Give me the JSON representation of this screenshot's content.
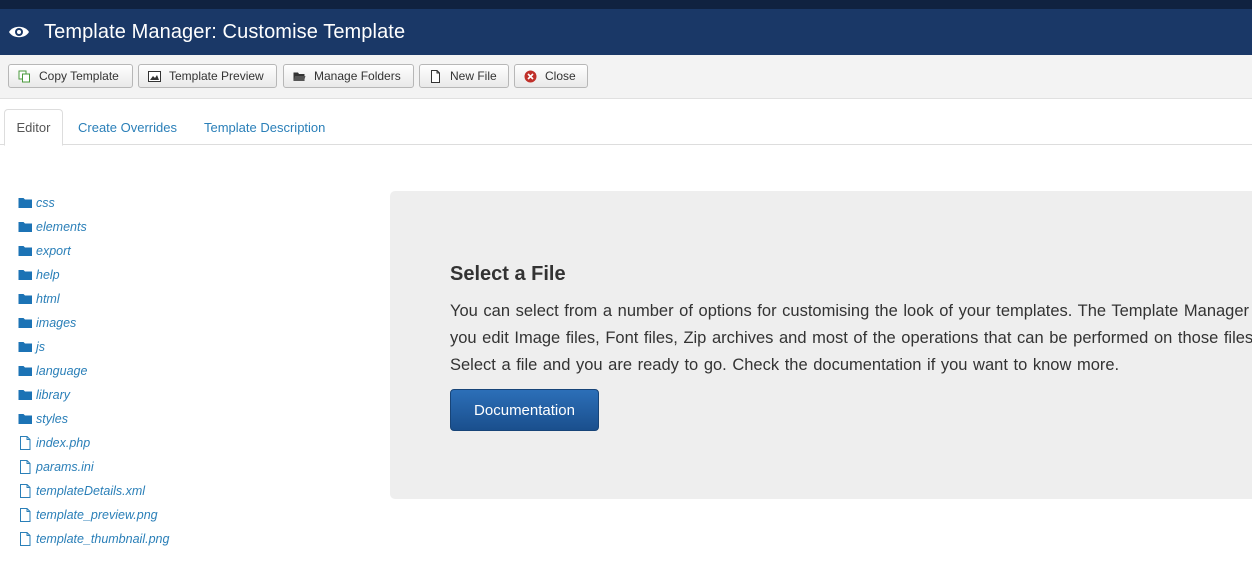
{
  "header": {
    "title": "Template Manager: Customise Template",
    "icon": "eye-icon"
  },
  "toolbar": {
    "copy_label": "Copy Template",
    "preview_label": "Template Preview",
    "folders_label": "Manage Folders",
    "newfile_label": "New File",
    "close_label": "Close"
  },
  "tabs": [
    {
      "label": "Editor",
      "active": true
    },
    {
      "label": "Create Overrides",
      "active": false
    },
    {
      "label": "Template Description",
      "active": false
    }
  ],
  "tree": [
    {
      "label": "css",
      "type": "folder"
    },
    {
      "label": "elements",
      "type": "folder"
    },
    {
      "label": "export",
      "type": "folder"
    },
    {
      "label": "help",
      "type": "folder"
    },
    {
      "label": "html",
      "type": "folder"
    },
    {
      "label": "images",
      "type": "folder"
    },
    {
      "label": "js",
      "type": "folder"
    },
    {
      "label": "language",
      "type": "folder"
    },
    {
      "label": "library",
      "type": "folder"
    },
    {
      "label": "styles",
      "type": "folder"
    },
    {
      "label": "index.php",
      "type": "file"
    },
    {
      "label": "params.ini",
      "type": "file"
    },
    {
      "label": "templateDetails.xml",
      "type": "file"
    },
    {
      "label": "template_preview.png",
      "type": "file"
    },
    {
      "label": "template_thumbnail.png",
      "type": "file"
    }
  ],
  "panel": {
    "heading": "Select a File",
    "text": "You can select from a number of options for customising the look of your templates. The Template Manager lets you edit Image files, Font files, Zip archives and most of the operations that can be performed on those files. Select a file and you are ready to go. Check the documentation if you want to know more.",
    "button_label": "Documentation"
  },
  "colors": {
    "header_bg": "#1a3867",
    "link": "#2a7fb8",
    "primary_button": "#1a4f8d"
  }
}
